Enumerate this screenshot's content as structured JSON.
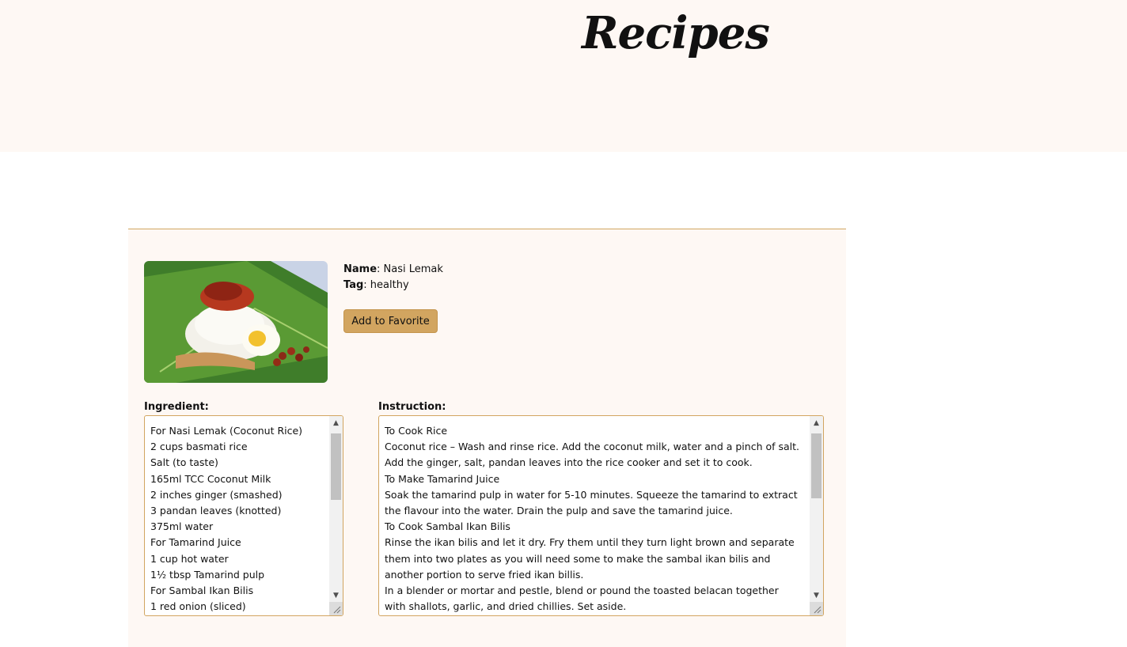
{
  "header": {
    "title": "Recipes"
  },
  "recipe": {
    "name_label": "Name",
    "name": "Nasi Lemak",
    "tag_label": "Tag",
    "tag": "healthy",
    "fav_button": "Add to Favorite",
    "ingredient_label": "Ingredient:",
    "instruction_label": "Instruction:",
    "ingredients": [
      " For Nasi Lemak (Coconut Rice)",
      "2 cups basmati rice",
      "Salt (to taste)",
      "165ml TCC Coconut Milk",
      "2 inches ginger (smashed)",
      "3 pandan leaves (knotted)",
      "375ml water",
      "For Tamarind Juice",
      "1 cup hot water",
      "1½ tbsp Tamarind pulp",
      "For Sambal Ikan Bilis",
      "1 red onion (sliced)"
    ],
    "instructions": [
      "To Cook Rice",
      "Coconut rice – Wash and rinse rice. Add the coconut milk, water and a pinch of salt.",
      "Add the ginger, salt, pandan leaves into the rice cooker and set it to cook.",
      "To Make Tamarind Juice",
      "Soak the tamarind pulp in water for 5-10 minutes. Squeeze the tamarind to extract",
      "the flavour into the water. Drain the pulp and save the tamarind juice.",
      "To Cook Sambal Ikan Bilis",
      "Rinse the ikan bilis and let it dry. Fry them until they turn light brown and separate",
      "them into two plates as you will need some to make the sambal ikan bilis and",
      "another portion to serve fried ikan billis.",
      "In a blender or mortar and pestle, blend or pound the toasted belacan together",
      "with shallots, garlic, and dried chillies. Set aside."
    ]
  }
}
